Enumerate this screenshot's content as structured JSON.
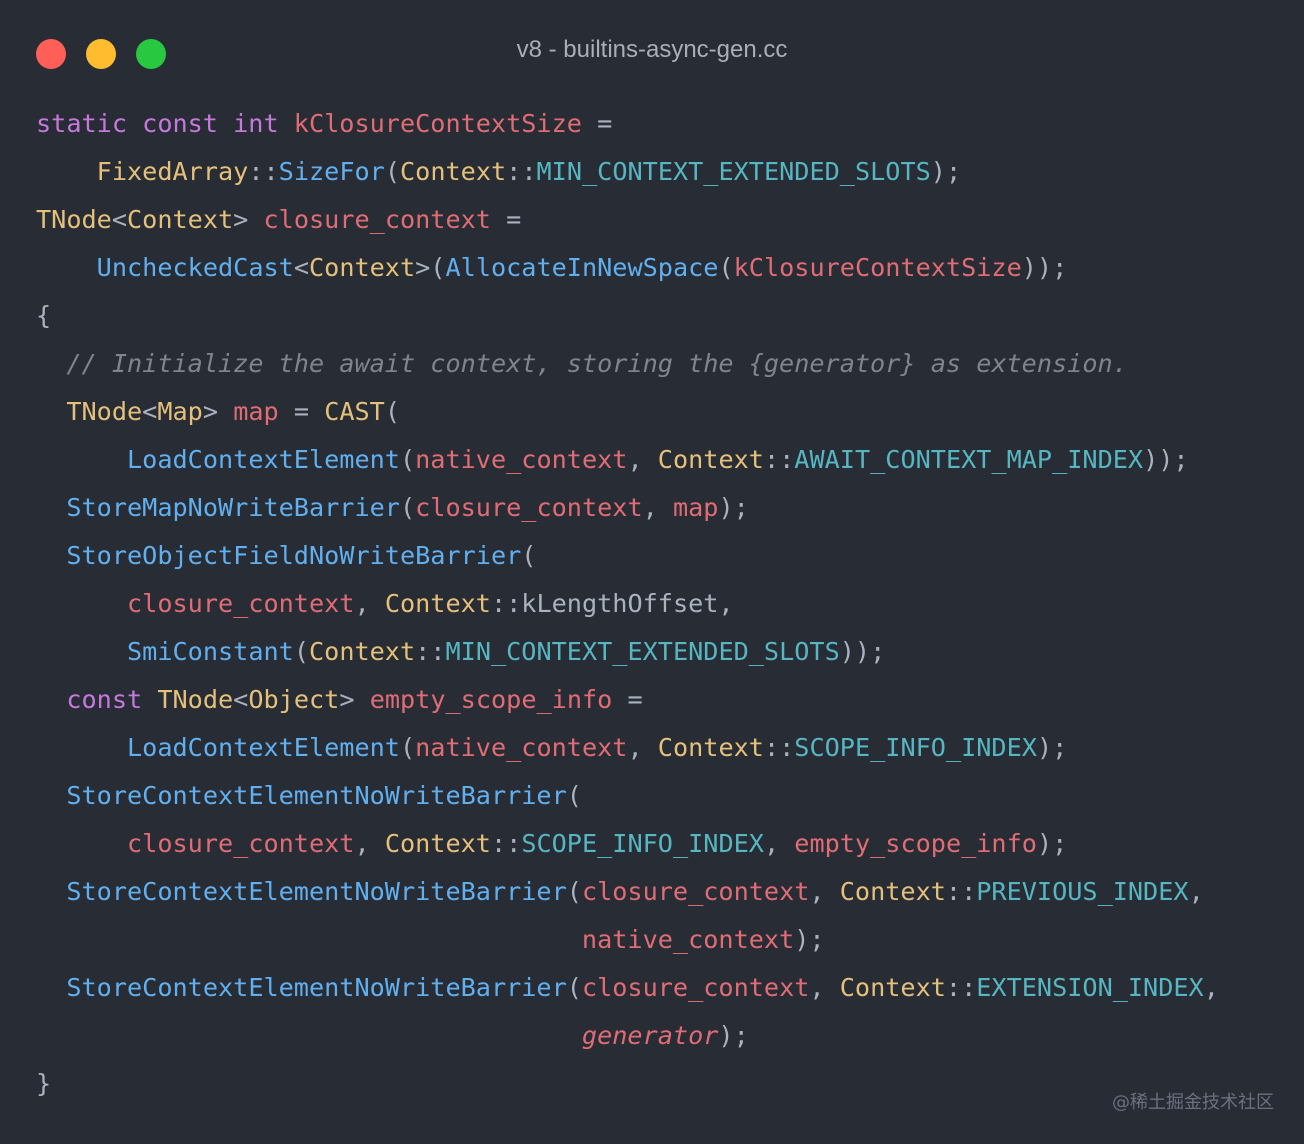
{
  "window": {
    "title": "v8 - builtins-async-gen.cc",
    "colors": {
      "close": "#ff5f57",
      "minimize": "#febc2e",
      "zoom": "#28c840",
      "background": "#282c34"
    }
  },
  "code": {
    "lines": [
      [
        [
          "kw",
          "static const int "
        ],
        [
          "va",
          "kClosureContextSize"
        ],
        [
          "pl",
          " ="
        ]
      ],
      [
        [
          "pl",
          "    "
        ],
        [
          "ty",
          "FixedArray"
        ],
        [
          "pl",
          "::"
        ],
        [
          "fn",
          "SizeFor"
        ],
        [
          "pl",
          "("
        ],
        [
          "ty",
          "Context"
        ],
        [
          "pl",
          "::"
        ],
        [
          "cs",
          "MIN_CONTEXT_EXTENDED_SLOTS"
        ],
        [
          "pl",
          ");"
        ]
      ],
      [
        [
          "ty",
          "TNode"
        ],
        [
          "pl",
          "<"
        ],
        [
          "ty",
          "Context"
        ],
        [
          "pl",
          "> "
        ],
        [
          "va",
          "closure_context"
        ],
        [
          "pl",
          " ="
        ]
      ],
      [
        [
          "pl",
          "    "
        ],
        [
          "fn",
          "UncheckedCast"
        ],
        [
          "pl",
          "<"
        ],
        [
          "ty",
          "Context"
        ],
        [
          "pl",
          ">("
        ],
        [
          "fn",
          "AllocateInNewSpace"
        ],
        [
          "pl",
          "("
        ],
        [
          "va",
          "kClosureContextSize"
        ],
        [
          "pl",
          "));"
        ]
      ],
      [
        [
          "pl",
          "{"
        ]
      ],
      [
        [
          "pl",
          "  "
        ],
        [
          "cm",
          "// Initialize the await context, storing the {generator} as extension."
        ]
      ],
      [
        [
          "pl",
          "  "
        ],
        [
          "ty",
          "TNode"
        ],
        [
          "pl",
          "<"
        ],
        [
          "ty",
          "Map"
        ],
        [
          "pl",
          "> "
        ],
        [
          "va",
          "map"
        ],
        [
          "pl",
          " = "
        ],
        [
          "ty",
          "CAST"
        ],
        [
          "pl",
          "("
        ]
      ],
      [
        [
          "pl",
          "      "
        ],
        [
          "fn",
          "LoadContextElement"
        ],
        [
          "pl",
          "("
        ],
        [
          "va",
          "native_context"
        ],
        [
          "pl",
          ", "
        ],
        [
          "ty",
          "Context"
        ],
        [
          "pl",
          "::"
        ],
        [
          "cs",
          "AWAIT_CONTEXT_MAP_INDEX"
        ],
        [
          "pl",
          "));"
        ]
      ],
      [
        [
          "pl",
          "  "
        ],
        [
          "fn",
          "StoreMapNoWriteBarrier"
        ],
        [
          "pl",
          "("
        ],
        [
          "va",
          "closure_context"
        ],
        [
          "pl",
          ", "
        ],
        [
          "va",
          "map"
        ],
        [
          "pl",
          ");"
        ]
      ],
      [
        [
          "pl",
          "  "
        ],
        [
          "fn",
          "StoreObjectFieldNoWriteBarrier"
        ],
        [
          "pl",
          "("
        ]
      ],
      [
        [
          "pl",
          "      "
        ],
        [
          "va",
          "closure_context"
        ],
        [
          "pl",
          ", "
        ],
        [
          "ty",
          "Context"
        ],
        [
          "pl",
          "::kLengthOffset,"
        ]
      ],
      [
        [
          "pl",
          "      "
        ],
        [
          "fn",
          "SmiConstant"
        ],
        [
          "pl",
          "("
        ],
        [
          "ty",
          "Context"
        ],
        [
          "pl",
          "::"
        ],
        [
          "cs",
          "MIN_CONTEXT_EXTENDED_SLOTS"
        ],
        [
          "pl",
          "));"
        ]
      ],
      [
        [
          "pl",
          "  "
        ],
        [
          "kw",
          "const "
        ],
        [
          "ty",
          "TNode"
        ],
        [
          "pl",
          "<"
        ],
        [
          "ty",
          "Object"
        ],
        [
          "pl",
          "> "
        ],
        [
          "va",
          "empty_scope_info"
        ],
        [
          "pl",
          " ="
        ]
      ],
      [
        [
          "pl",
          "      "
        ],
        [
          "fn",
          "LoadContextElement"
        ],
        [
          "pl",
          "("
        ],
        [
          "va",
          "native_context"
        ],
        [
          "pl",
          ", "
        ],
        [
          "ty",
          "Context"
        ],
        [
          "pl",
          "::"
        ],
        [
          "cs",
          "SCOPE_INFO_INDEX"
        ],
        [
          "pl",
          ");"
        ]
      ],
      [
        [
          "pl",
          "  "
        ],
        [
          "fn",
          "StoreContextElementNoWriteBarrier"
        ],
        [
          "pl",
          "("
        ]
      ],
      [
        [
          "pl",
          "      "
        ],
        [
          "va",
          "closure_context"
        ],
        [
          "pl",
          ", "
        ],
        [
          "ty",
          "Context"
        ],
        [
          "pl",
          "::"
        ],
        [
          "cs",
          "SCOPE_INFO_INDEX"
        ],
        [
          "pl",
          ", "
        ],
        [
          "va",
          "empty_scope_info"
        ],
        [
          "pl",
          ");"
        ]
      ],
      [
        [
          "pl",
          "  "
        ],
        [
          "fn",
          "StoreContextElementNoWriteBarrier"
        ],
        [
          "pl",
          "("
        ],
        [
          "va",
          "closure_context"
        ],
        [
          "pl",
          ", "
        ],
        [
          "ty",
          "Context"
        ],
        [
          "pl",
          "::"
        ],
        [
          "cs",
          "PREVIOUS_INDEX"
        ],
        [
          "pl",
          ","
        ]
      ],
      [
        [
          "pl",
          "                                    "
        ],
        [
          "va",
          "native_context"
        ],
        [
          "pl",
          ");"
        ]
      ],
      [
        [
          "pl",
          "  "
        ],
        [
          "fn",
          "StoreContextElementNoWriteBarrier"
        ],
        [
          "pl",
          "("
        ],
        [
          "va",
          "closure_context"
        ],
        [
          "pl",
          ", "
        ],
        [
          "ty",
          "Context"
        ],
        [
          "pl",
          "::"
        ],
        [
          "cs",
          "EXTENSION_INDEX"
        ],
        [
          "pl",
          ","
        ]
      ],
      [
        [
          "pl",
          "                                    "
        ],
        [
          "vi",
          "generator"
        ],
        [
          "pl",
          ");"
        ]
      ],
      [
        [
          "pl",
          "}"
        ]
      ]
    ]
  },
  "watermark": "@稀土掘金技术社区"
}
